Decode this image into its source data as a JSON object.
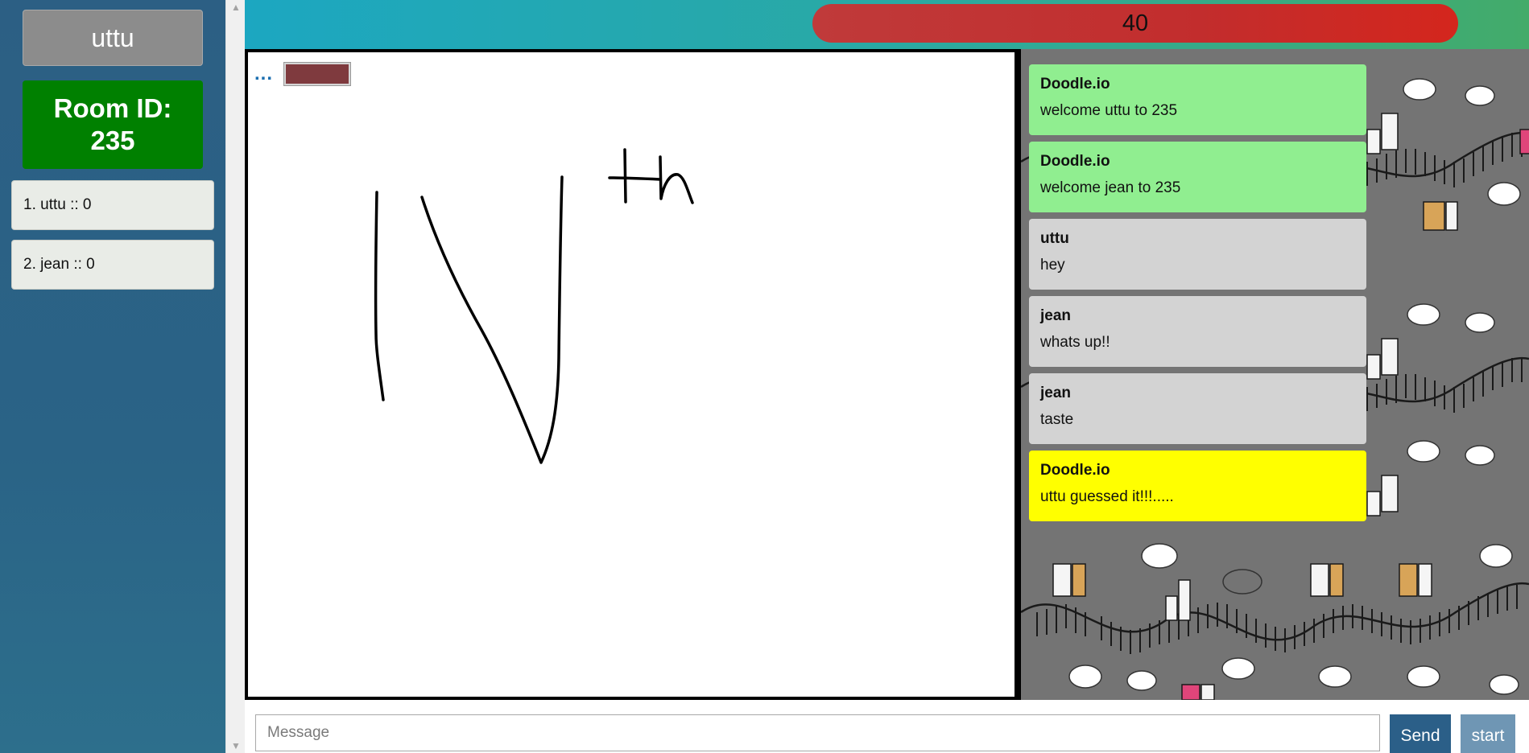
{
  "sidebar": {
    "username": "uttu",
    "room_label": "Room ID:",
    "room_id": "235",
    "players": [
      {
        "label": "1. uttu :: 0"
      },
      {
        "label": "2. jean :: 0"
      }
    ]
  },
  "timer": {
    "value": "40"
  },
  "canvas": {
    "dots_icon": "...",
    "brush_color": "#7f3a3e",
    "drawing_icon": "handwritten-scribble"
  },
  "chat": {
    "messages": [
      {
        "sender": "Doodle.io",
        "text": "welcome uttu to 235",
        "color": "#90ee90"
      },
      {
        "sender": "Doodle.io",
        "text": "welcome jean to 235",
        "color": "#90ee90"
      },
      {
        "sender": "uttu",
        "text": "hey",
        "color": "#d3d3d3"
      },
      {
        "sender": "jean",
        "text": "whats up!!",
        "color": "#d3d3d3"
      },
      {
        "sender": "jean",
        "text": "taste",
        "color": "#d3d3d3"
      },
      {
        "sender": "Doodle.io",
        "text": "uttu guessed it!!!.....",
        "color": "#ffff00"
      }
    ]
  },
  "input": {
    "placeholder": "Message",
    "value": ""
  },
  "buttons": {
    "send": "Send",
    "start": "start"
  },
  "colors": {
    "sidebar": "#2c6386",
    "room_box": "#008000",
    "timer": "#c8302c",
    "send_button": "#2b5f88",
    "start_button": "#6f96b4"
  }
}
